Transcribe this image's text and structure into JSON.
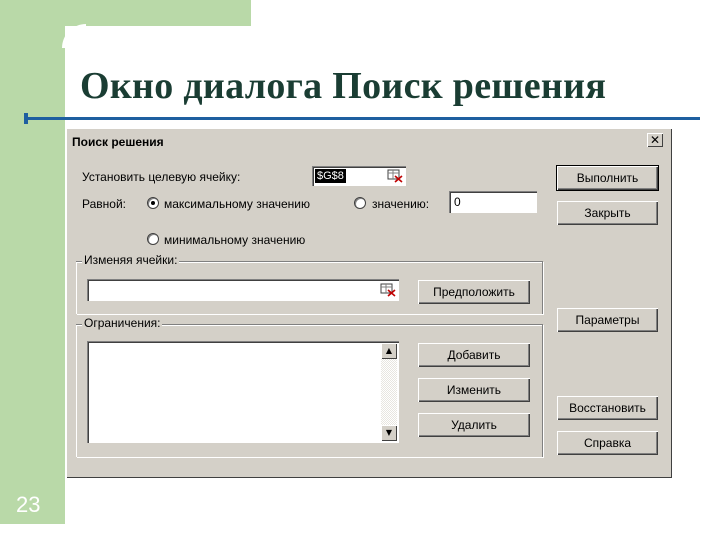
{
  "slide": {
    "title": "Окно диалога Поиск решения",
    "number": "23"
  },
  "dialog": {
    "title": "Поиск решения",
    "close_glyph": "✕",
    "target_cell_label": "Установить целевую ячейку:",
    "target_cell_value": "$G$8",
    "equal_to_label": "Равной:",
    "radio_max_label": "максимальному значению",
    "radio_value_label": "значению:",
    "value_input": "0",
    "radio_min_label": "минимальному значению",
    "selected_option": "максимальному значению",
    "changing_cells_label": "Изменяя ячейки:",
    "changing_cells_value": "",
    "constraints_label": "Ограничения:",
    "constraints_items": [],
    "buttons": {
      "solve": "Выполнить",
      "close": "Закрыть",
      "guess": "Предположить",
      "options": "Параметры",
      "add": "Добавить",
      "change": "Изменить",
      "delete": "Удалить",
      "reset": "Восстановить",
      "help": "Справка"
    },
    "icons": {
      "collapse_dialog": "range-select-icon",
      "scroll_up": "scroll-up-arrow-icon",
      "scroll_down": "scroll-down-arrow-icon"
    },
    "colors": {
      "dialog_bg": "#d4d0c8",
      "slide_accent_green": "#b9d9a8",
      "title_color": "#1a3d33",
      "rule_blue": "#1e5fa0"
    }
  }
}
